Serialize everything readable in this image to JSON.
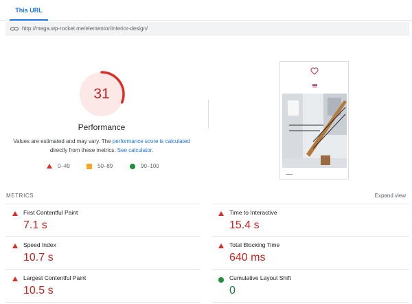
{
  "tabs": [
    {
      "label": "This URL",
      "active": true
    }
  ],
  "url": "http://mega.wp-rocket.me/elementor/interior-design/",
  "performance": {
    "score": "31",
    "score_fraction": 0.31,
    "title": "Performance",
    "desc_prefix": "Values are estimated and may vary. The ",
    "desc_link1": "performance score is calculated",
    "desc_mid": " directly from these metrics. ",
    "desc_link2": "See calculator",
    "desc_suffix": "."
  },
  "legend": [
    {
      "range": "0–49",
      "shape": "triangle",
      "color": "#d93025"
    },
    {
      "range": "50–89",
      "shape": "square",
      "color": "#f9a825"
    },
    {
      "range": "90–100",
      "shape": "circle",
      "color": "#1e8e3e"
    }
  ],
  "metrics_header": "METRICS",
  "expand_label": "Expand view",
  "metrics": [
    {
      "name": "First Contentful Paint",
      "value": "7.1 s",
      "status": "poor"
    },
    {
      "name": "Time to Interactive",
      "value": "15.4 s",
      "status": "poor"
    },
    {
      "name": "Speed Index",
      "value": "10.7 s",
      "status": "poor"
    },
    {
      "name": "Total Blocking Time",
      "value": "640 ms",
      "status": "poor"
    },
    {
      "name": "Largest Contentful Paint",
      "value": "10.5 s",
      "status": "poor"
    },
    {
      "name": "Cumulative Layout Shift",
      "value": "0",
      "status": "good"
    }
  ],
  "colors": {
    "accent": "#1a73e8",
    "poor": "#d93025",
    "average": "#f9a825",
    "good": "#1e8e3e"
  },
  "icons": {
    "url": "link-icon",
    "phone_top": "heart-icon",
    "phone_menu": "menu-icon"
  }
}
